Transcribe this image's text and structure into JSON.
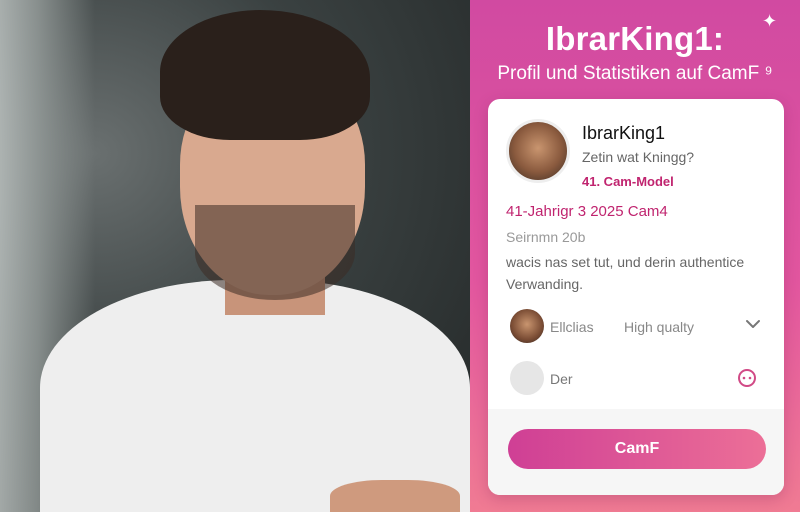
{
  "header": {
    "title": "IbrarKing1:",
    "subtitle": "Profil und Statistiken auf CamF ⁹"
  },
  "profile": {
    "username": "IbrarKing1",
    "subline": "Zetin wat Kningg?",
    "model_label": "41. Cam-Model",
    "age_line": "41-Jahrigr 3 2025  Cam4",
    "since": "Seirnmn 20b",
    "description": "wacis nas set tut, und derin authentice Verwanding."
  },
  "details": {
    "category_label": "Ellclias",
    "quality_label": "High qualty",
    "second_row_label": "Der"
  },
  "cta": {
    "label": "CamF"
  },
  "icons": {
    "sparkle": "sparkle-icon",
    "chevron": "chevron-down-icon",
    "row_action": "circle-options-icon"
  },
  "colors": {
    "accent": "#c0246f",
    "panel_top": "#d14aa1",
    "panel_bottom": "#f07b93"
  }
}
